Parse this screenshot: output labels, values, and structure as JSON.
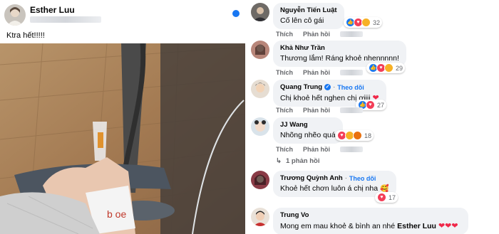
{
  "post": {
    "author": "Esther Luu",
    "text": "Ktra hết!!!!!",
    "photo_mark": "b oe"
  },
  "comments": [
    {
      "name": "Nguyễn Tiến Luật",
      "text": "Cố lên cô gái",
      "reaction_count": "32"
    },
    {
      "name": "Khả Như Trần",
      "text": "Thương lắm! Ráng khoẻ nhennnnn!",
      "reaction_count": "29"
    },
    {
      "name": "Quang Trung",
      "follow": "Theo dõi",
      "text": "Chị khoẻ hết nghen chị ơiiii",
      "reaction_count": "27"
    },
    {
      "name": "JJ Wang",
      "text": "Nhõng nhẽo quá",
      "reaction_count": "18"
    },
    {
      "name": "Trương Quỳnh Anh",
      "follow": "Theo dõi",
      "text": "Khoẻ hết chơn luôn á chị nha",
      "reaction_count": "17"
    },
    {
      "name": "Trung Vo",
      "text": "Mong em mau khoẻ & bình an nhé",
      "mention": "Esther Luu"
    }
  ],
  "actions": {
    "like": "Thích",
    "reply": "Phản hồi"
  },
  "replies_label": "1 phản hồi",
  "colors": {
    "accent": "#1877f2",
    "bubble": "#f0f2f5",
    "muted": "#65676b"
  }
}
